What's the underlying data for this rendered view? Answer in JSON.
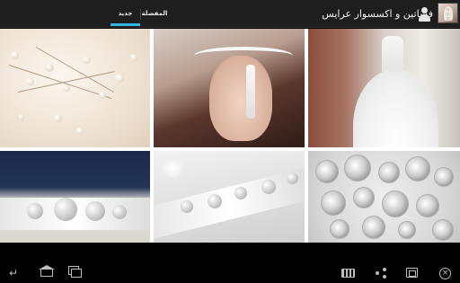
{
  "action_bar": {
    "title": "فساتين و اكسسوار عرايس",
    "tabs": [
      {
        "label": "جديد",
        "selected": true
      },
      {
        "label": "المفضلة",
        "selected": false
      }
    ],
    "accent_color": "#33b5e5",
    "icons": [
      "app-logo",
      "user-icon",
      "overflow-menu-icon"
    ]
  },
  "gallery": {
    "items": [
      {
        "subject": "pearl hair comb"
      },
      {
        "subject": "crystal headband"
      },
      {
        "subject": "wedding dress"
      },
      {
        "subject": "crystal belt"
      },
      {
        "subject": "rhinestone sash"
      },
      {
        "subject": "brooch bouquet"
      }
    ]
  },
  "nav_bar": {
    "icons": [
      "back-icon",
      "home-icon",
      "recents-icon",
      "keyboard-icon",
      "share-icon",
      "window-icon",
      "close-icon"
    ]
  },
  "close_glyph": "×"
}
